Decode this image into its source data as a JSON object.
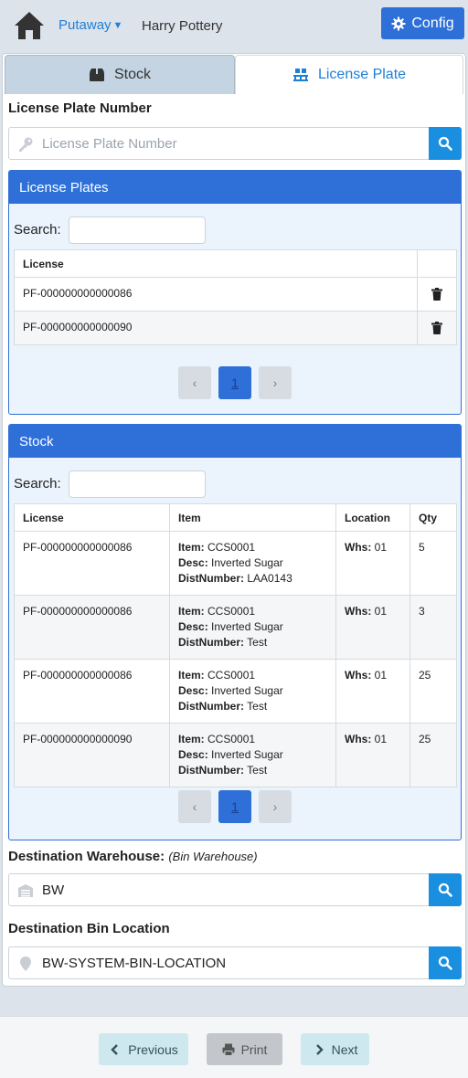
{
  "header": {
    "module": "Putaway",
    "user": "Harry Pottery",
    "config_label": "Config"
  },
  "tabs": [
    {
      "label": "Stock",
      "icon": "box-icon",
      "active": false
    },
    {
      "label": "License Plate",
      "icon": "pallet-icon",
      "active": true
    }
  ],
  "license_plate_number": {
    "label": "License Plate Number",
    "placeholder": "License Plate Number",
    "value": ""
  },
  "license_plates_panel": {
    "title": "License Plates",
    "search_label": "Search:",
    "columns": [
      "License",
      ""
    ],
    "rows": [
      {
        "license": "PF-000000000000086"
      },
      {
        "license": "PF-000000000000090"
      }
    ],
    "pagination": {
      "prev": "‹",
      "current": "1",
      "next": "›"
    }
  },
  "stock_panel": {
    "title": "Stock",
    "search_label": "Search:",
    "columns": [
      "License",
      "Item",
      "Location",
      "Qty"
    ],
    "field_labels": {
      "item": "Item:",
      "desc": "Desc:",
      "dist": "DistNumber:",
      "whs": "Whs:"
    },
    "rows": [
      {
        "license": "PF-000000000000086",
        "item": "CCS0001",
        "desc": "Inverted Sugar",
        "dist": "LAA0143",
        "whs": "01",
        "qty": "5"
      },
      {
        "license": "PF-000000000000086",
        "item": "CCS0001",
        "desc": "Inverted Sugar",
        "dist": "Test",
        "whs": "01",
        "qty": "3"
      },
      {
        "license": "PF-000000000000086",
        "item": "CCS0001",
        "desc": "Inverted Sugar",
        "dist": "Test",
        "whs": "01",
        "qty": "25"
      },
      {
        "license": "PF-000000000000090",
        "item": "CCS0001",
        "desc": "Inverted Sugar",
        "dist": "Test",
        "whs": "01",
        "qty": "25"
      }
    ],
    "pagination": {
      "prev": "‹",
      "current": "1",
      "next": "›"
    }
  },
  "destination_warehouse": {
    "label": "Destination Warehouse:",
    "hint": "(Bin Warehouse)",
    "value": "BW"
  },
  "destination_bin": {
    "label": "Destination Bin Location",
    "value": "BW-SYSTEM-BIN-LOCATION"
  },
  "footer": {
    "previous": "Previous",
    "print": "Print",
    "next": "Next"
  },
  "colors": {
    "primary": "#2e6fd8",
    "search_button": "#1a8fe0",
    "link": "#1e7fd6"
  }
}
